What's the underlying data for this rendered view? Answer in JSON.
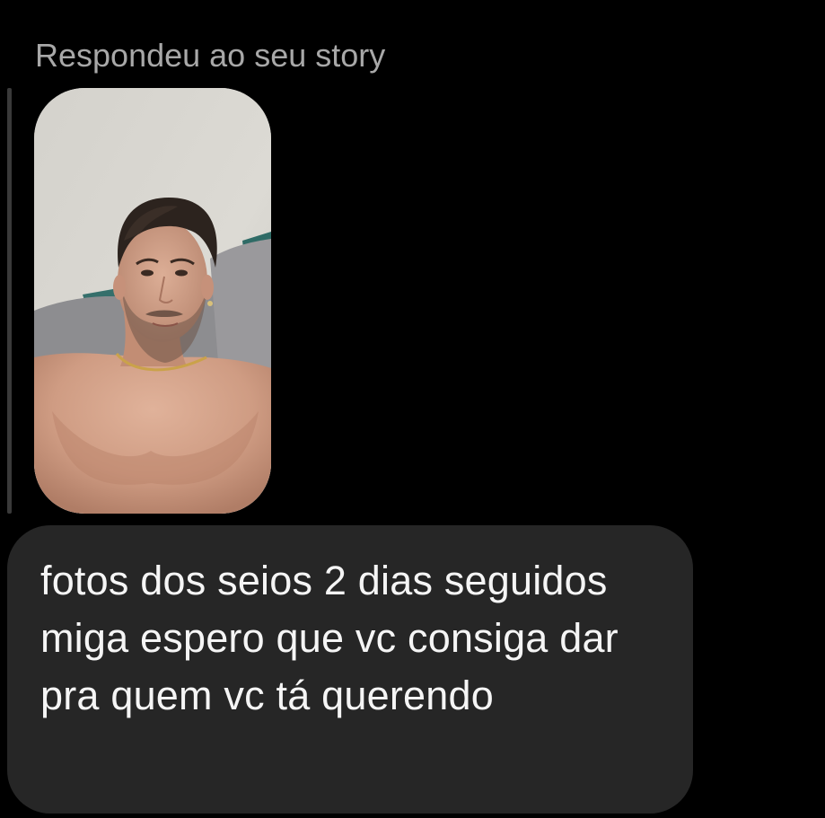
{
  "thread": {
    "reply_label": "Respondeu ao seu story"
  },
  "story": {
    "thumbnail_icon": "story-photo-thumbnail",
    "colors": {
      "wall": "#d8d6d0",
      "pillow": "#8b8b8d",
      "accent_fabric": "#2e6f6a",
      "skin": "#c9977e"
    }
  },
  "message": {
    "text": "fotos dos seios 2 dias seguidos miga espero que vc consiga dar pra quem vc tá querendo"
  },
  "theme": {
    "background": "#000000",
    "bubble": "#262626",
    "label": "#a8a8a8",
    "text": "#f5f5f5"
  }
}
